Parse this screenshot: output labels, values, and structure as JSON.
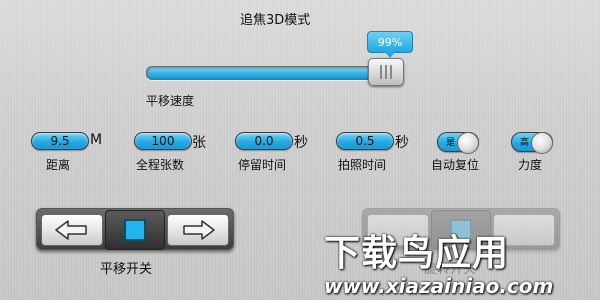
{
  "header": {
    "title": "追焦3D模式"
  },
  "speed_slider": {
    "label": "平移速度",
    "value_text": "99%",
    "fraction": 0.99
  },
  "params": {
    "distance": {
      "value": "9.5",
      "unit": "M",
      "label": "距离"
    },
    "shots": {
      "value": "100",
      "unit": "张",
      "label": "全程张数"
    },
    "dwell": {
      "value": "0.0",
      "unit": "秒",
      "label": "停留时间"
    },
    "shutter": {
      "value": "0.5",
      "unit": "秒",
      "label": "拍照时间"
    }
  },
  "toggles": {
    "auto_reset": {
      "state_text": "是",
      "label": "自动复位"
    },
    "force": {
      "state_text": "高",
      "label": "力度"
    }
  },
  "pan_switch": {
    "label": "平移开关"
  },
  "secondary_switch": {
    "label": "旋转开关"
  },
  "watermark": {
    "main": "下载鸟应用",
    "url": "www.xiazainiao.com"
  },
  "colors": {
    "accent": "#25aae4",
    "stop_square": "#23b3ee",
    "background": "#cfcfcf"
  }
}
